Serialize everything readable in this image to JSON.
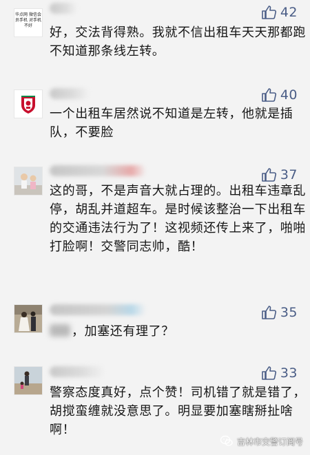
{
  "comments": [
    {
      "likes": "42",
      "avatar_text": "华点网 微信会员手机 对手机不好",
      "text": "好，交法背得熟。我就不信出租车天天那都跑不知道那条线左转。"
    },
    {
      "likes": "40",
      "avatar_icon": "liverpool-crest-icon",
      "text": "一个出租车居然说不知道是左转，他就是插队，不要脸"
    },
    {
      "likes": "37",
      "avatar_icon": "children-photo-icon",
      "text": "这的哥，不是声音大就占理的。出租车违章乱停，胡乱并道超车。是时候该整治一下出租车的交通违法行为了！这视频还传上来了，啪啪打脸啊！交警同志帅，酷！"
    },
    {
      "likes": "35",
      "avatar_icon": "wedding-photo-icon",
      "text": "，加塞还有理了？"
    },
    {
      "likes": "33",
      "avatar_icon": "beach-photo-icon",
      "text": "警察态度真好，点个赞！司机错了就是错了，胡搅蛮缠就没意思了。明显要加塞瞎掰扯啥啊！"
    }
  ],
  "watermark": "吉林市交警订阅号",
  "colors": {
    "like_blue": "#4a5d86",
    "background": "#f3f3f3"
  }
}
